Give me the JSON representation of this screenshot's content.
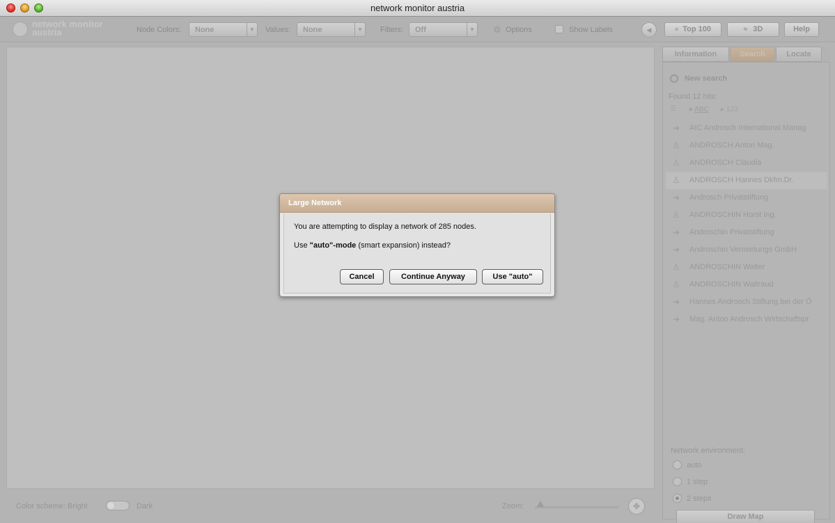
{
  "window": {
    "title": "network monitor austria"
  },
  "toolbar": {
    "logo_text_line1": "network monitor",
    "logo_text_line2": "austria",
    "node_colors_label": "Node Colors:",
    "node_colors_value": "None",
    "values_label": "Values:",
    "values_value": "None",
    "filters_label": "Filters:",
    "filters_value": "Off",
    "options_label": "Options",
    "show_labels_label": "Show Labels",
    "top100_label": "Top 100",
    "three_d_label": "3D",
    "help_label": "Help"
  },
  "panel": {
    "tabs": [
      {
        "label": "Information"
      },
      {
        "label": "Search",
        "active": true
      },
      {
        "label": "Locate"
      }
    ],
    "new_search": "New search",
    "found": "Found 12 hits:",
    "sort_abc": "ABC",
    "sort_num": "123",
    "results": [
      {
        "icon": "company-icon",
        "label": "AIC Androsch International Manag"
      },
      {
        "icon": "person-icon",
        "label": "ANDROSCH Anton Mag."
      },
      {
        "icon": "person-icon",
        "label": "ANDROSCH Claudia"
      },
      {
        "icon": "person-icon",
        "label": "ANDROSCH Hannes Dkfm.Dr.",
        "selected": true
      },
      {
        "icon": "company-icon",
        "label": "Androsch Privatstiftung"
      },
      {
        "icon": "person-icon",
        "label": "ANDROSCHIN Horst Ing."
      },
      {
        "icon": "company-icon",
        "label": "Androschin Privatstiftung"
      },
      {
        "icon": "company-icon",
        "label": "Androschin Vermietungs GmbH"
      },
      {
        "icon": "person-icon",
        "label": "ANDROSCHIN Walter"
      },
      {
        "icon": "person-icon",
        "label": "ANDROSCHIN Waltraud"
      },
      {
        "icon": "company-icon",
        "label": "Hannes Androsch Stiftung bei der Ö"
      },
      {
        "icon": "company-icon",
        "label": "Mag. Anton Androsch Wirtschaftspr"
      }
    ],
    "network_env_label": "Network environment:",
    "env_options": [
      {
        "label": "auto",
        "selected": false
      },
      {
        "label": "1 step",
        "selected": false
      },
      {
        "label": "2 steps",
        "selected": true
      }
    ],
    "draw_map": "Draw Map"
  },
  "statusbar": {
    "color_scheme_label": "Color scheme: Bright",
    "dark_label": "Dark",
    "zoom_label": "Zoom:"
  },
  "dialog": {
    "title": "Large Network",
    "message1": "You are attempting to display a network of 285 nodes.",
    "message2_pre": "Use ",
    "message2_bold": "\"auto\"-mode",
    "message2_post": " (smart expansion) instead?",
    "cancel": "Cancel",
    "continue": "Continue Anyway",
    "use_auto": "Use \"auto\""
  }
}
